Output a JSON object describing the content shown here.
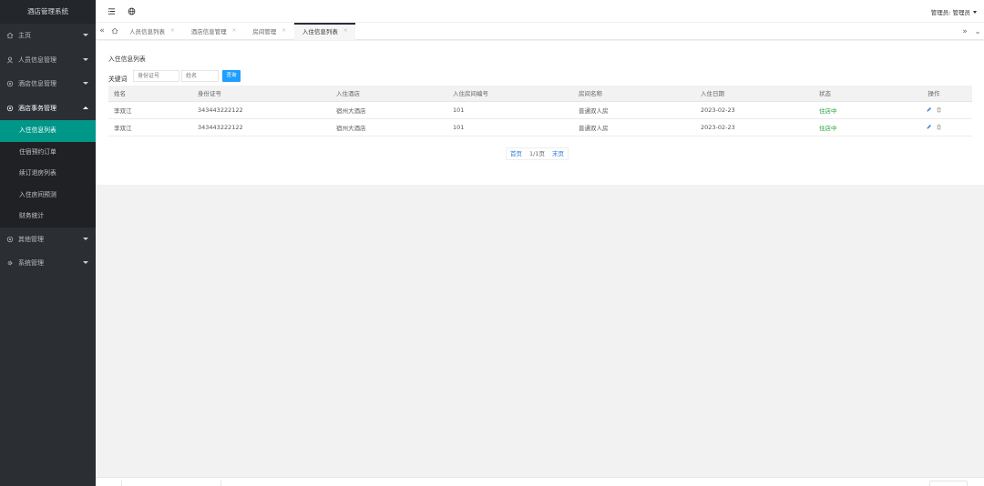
{
  "sidebar": {
    "title": "酒店管理系统",
    "items": [
      {
        "label": "主页",
        "icon": "home-icon"
      },
      {
        "label": "人员信息管理",
        "icon": "user-icon"
      },
      {
        "label": "酒店信息管理",
        "icon": "settings-icon"
      },
      {
        "label": "酒店事务管理",
        "icon": "settings-icon"
      }
    ],
    "subitems": [
      {
        "label": "入住信息列表",
        "active": true
      },
      {
        "label": "住宿预约订单",
        "active": false
      },
      {
        "label": "续订退房列表",
        "active": false
      },
      {
        "label": "入住房间预测",
        "active": false
      },
      {
        "label": "财务统计",
        "active": false
      }
    ],
    "bottom_items": [
      {
        "label": "其他管理",
        "icon": "settings-icon"
      },
      {
        "label": "系统管理",
        "icon": "gear-icon"
      }
    ]
  },
  "header": {
    "admin_label": "管理员: 管理员"
  },
  "tabs": [
    {
      "label": "人员信息列表",
      "active": false
    },
    {
      "label": "酒店信息管理",
      "active": false
    },
    {
      "label": "房间管理",
      "active": false
    },
    {
      "label": "入住信息列表",
      "active": true
    }
  ],
  "panel": {
    "title": "入住信息列表",
    "keyword_label": "关键词",
    "id_placeholder": "身份证号",
    "name_placeholder": "姓名",
    "search_label": "查询"
  },
  "table": {
    "headers": [
      "姓名",
      "身份证号",
      "入住酒店",
      "入住房间编号",
      "房间名称",
      "入住日期",
      "状态",
      "操作"
    ],
    "rows": [
      [
        "李双江",
        "343443222122",
        "宿州大酒店",
        "101",
        "普通双人房",
        "2023-02-23",
        "住店中"
      ],
      [
        "李双江",
        "343443222122",
        "宿州大酒店",
        "101",
        "普通双人房",
        "2023-02-23",
        "住店中"
      ]
    ]
  },
  "pager": {
    "first": "首页",
    "info": "1/1页",
    "last": "末页"
  },
  "colors": {
    "sidebar_bg": "#2b2e33",
    "active_item": "#009688",
    "primary_button": "#1e9fff",
    "status_green": "#23a23a",
    "link_blue": "#2b7bd9"
  }
}
